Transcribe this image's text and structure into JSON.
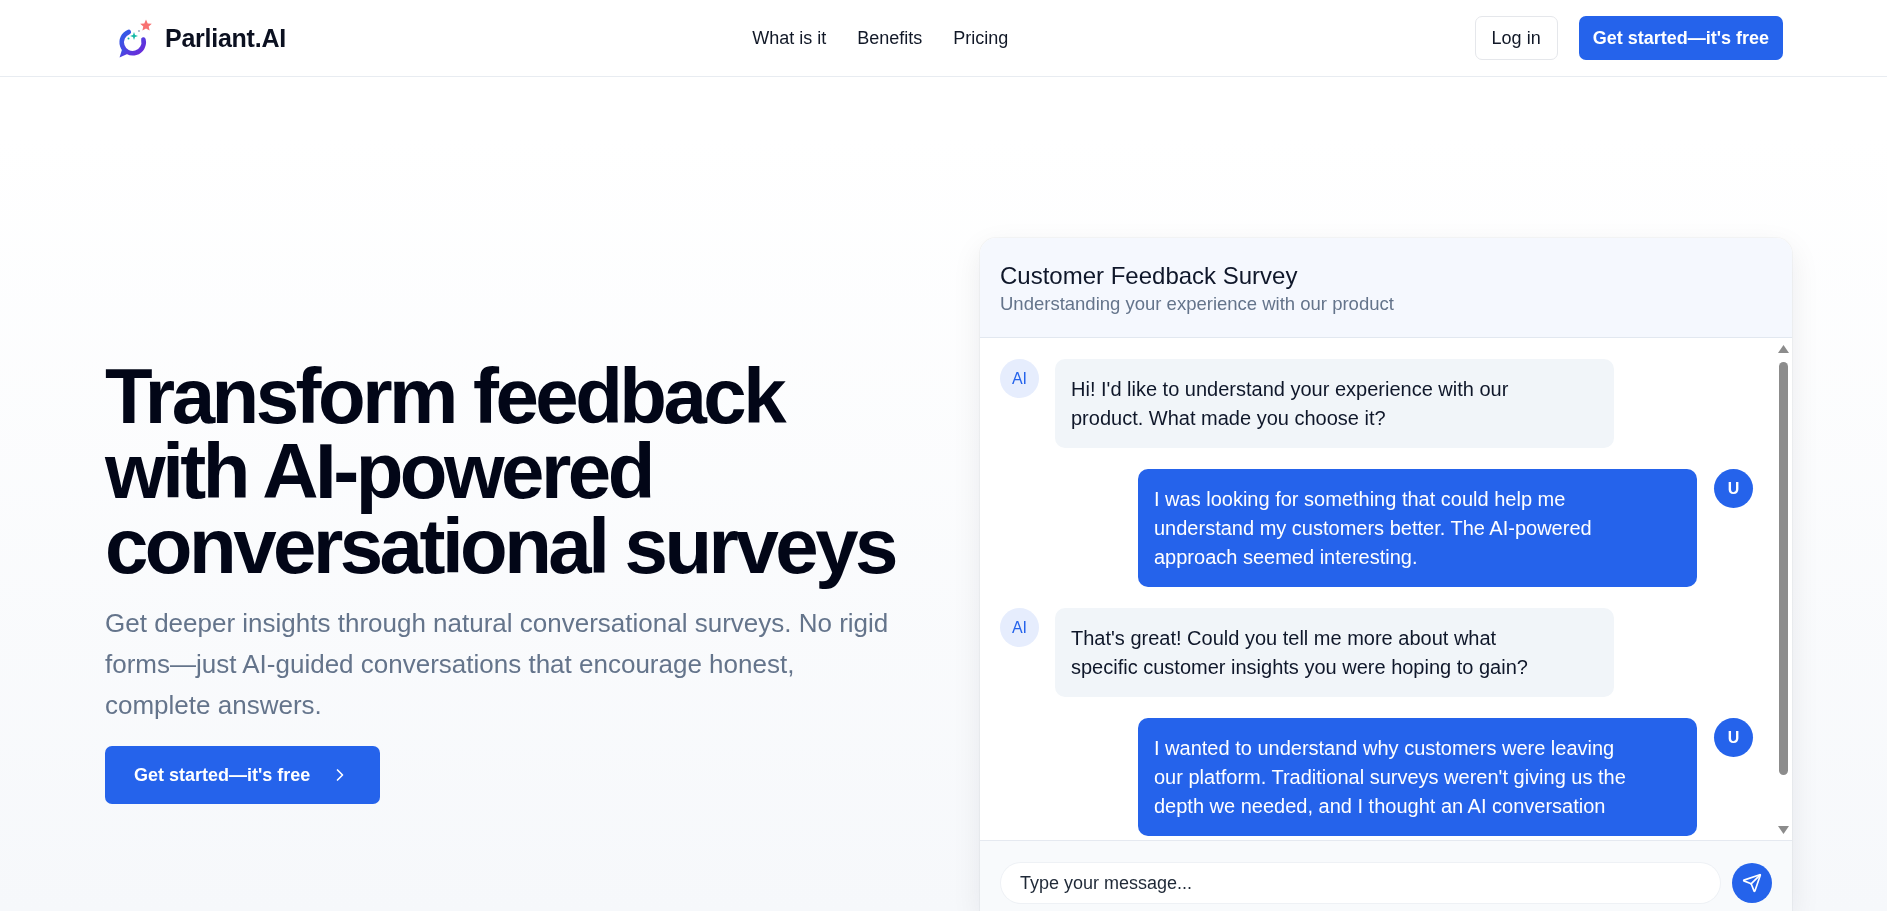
{
  "header": {
    "logo": "Parliant.AI",
    "nav": [
      "What is it",
      "Benefits",
      "Pricing"
    ],
    "login_button": "Log in",
    "cta_button": "Get started—it's free"
  },
  "hero": {
    "heading": "Transform feedback with AI-powered conversational surveys",
    "subheading": "Get deeper insights through natural conversational surveys. No rigid forms—just AI-guided conversations that encourage honest, complete answers.",
    "cta_button": "Get started—it's free"
  },
  "chat": {
    "title": "Customer Feedback Survey",
    "subtitle": "Understanding your experience with our product",
    "messages": [
      {
        "kind": "ai",
        "avatar": "AI",
        "text": "Hi! I'd like to understand your experience with our product. What made you choose it?"
      },
      {
        "kind": "user",
        "avatar": "U",
        "text": "I was looking for something that could help me understand my customers better. The AI-powered approach seemed interesting."
      },
      {
        "kind": "ai",
        "avatar": "AI",
        "text": "That's great! Could you tell me more about what specific customer insights you were hoping to gain?"
      },
      {
        "kind": "user",
        "avatar": "U",
        "text": "I wanted to understand why customers were leaving our platform. Traditional surveys weren't giving us the depth we needed, and I thought an AI conversation"
      }
    ],
    "input": {
      "placeholder": "Type your message..."
    }
  }
}
